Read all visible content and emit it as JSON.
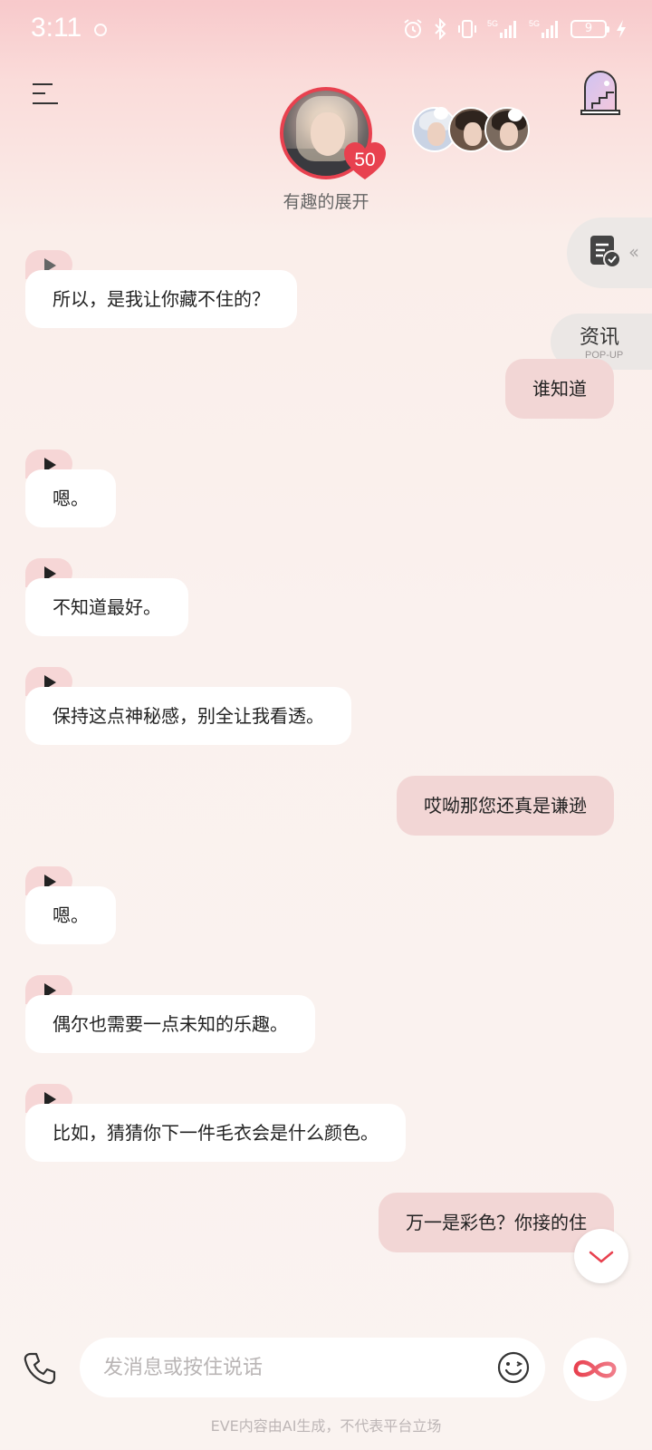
{
  "status_bar": {
    "time": "3:11",
    "battery": "9"
  },
  "header": {
    "avatar_caption": "有趣的展开",
    "affinity": "50"
  },
  "side": {
    "news_title": "资讯",
    "news_sub": "POP-UP"
  },
  "messages": [
    {
      "role": "bot",
      "text": "所以，是我让你藏不住的？"
    },
    {
      "role": "user",
      "text": "谁知道"
    },
    {
      "role": "bot",
      "text": "嗯。"
    },
    {
      "role": "bot",
      "text": "不知道最好。"
    },
    {
      "role": "bot",
      "text": "保持这点神秘感，别全让我看透。"
    },
    {
      "role": "user",
      "text": "哎呦那您还真是谦逊"
    },
    {
      "role": "bot",
      "text": "嗯。"
    },
    {
      "role": "bot",
      "text": "偶尔也需要一点未知的乐趣。"
    },
    {
      "role": "bot",
      "text": "比如，猜猜你下一件毛衣会是什么颜色。"
    },
    {
      "role": "user",
      "text": "万一是彩色？你接的住"
    }
  ],
  "input": {
    "placeholder": "发消息或按住说话",
    "value": ""
  },
  "footer": {
    "disclaimer": "EVE内容由AI生成，不代表平台立场"
  },
  "colors": {
    "accent": "#e8414f",
    "user_bubble": "#f2d6d5",
    "play_tag": "#f6d6d6"
  },
  "icons": [
    "menu-icon",
    "window-icon",
    "task-icon",
    "phone-icon",
    "emoji-icon",
    "infinity-icon",
    "chevron-down-icon",
    "play-icon",
    "heart-icon"
  ]
}
